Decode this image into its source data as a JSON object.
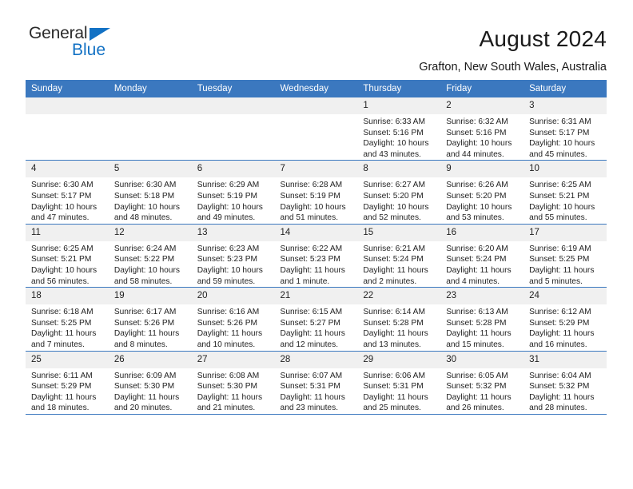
{
  "brand": {
    "name_top": "General",
    "name_bottom": "Blue",
    "triangle_color": "#1271c4",
    "text_color": "#2b2b2b"
  },
  "header": {
    "title": "August 2024",
    "subtitle": "Grafton, New South Wales, Australia",
    "header_bg": "#3b78bf",
    "daynum_bg": "#f0f0f0"
  },
  "weekday_headers": [
    "Sunday",
    "Monday",
    "Tuesday",
    "Wednesday",
    "Thursday",
    "Friday",
    "Saturday"
  ],
  "labels": {
    "sunrise": "Sunrise:",
    "sunset": "Sunset:",
    "daylight": "Daylight:"
  },
  "weeks": [
    [
      {
        "day": "",
        "empty": true
      },
      {
        "day": "",
        "empty": true
      },
      {
        "day": "",
        "empty": true
      },
      {
        "day": "",
        "empty": true
      },
      {
        "day": "1",
        "sunrise": "Sunrise: 6:33 AM",
        "sunset": "Sunset: 5:16 PM",
        "daylight1": "Daylight: 10 hours",
        "daylight2": "and 43 minutes."
      },
      {
        "day": "2",
        "sunrise": "Sunrise: 6:32 AM",
        "sunset": "Sunset: 5:16 PM",
        "daylight1": "Daylight: 10 hours",
        "daylight2": "and 44 minutes."
      },
      {
        "day": "3",
        "sunrise": "Sunrise: 6:31 AM",
        "sunset": "Sunset: 5:17 PM",
        "daylight1": "Daylight: 10 hours",
        "daylight2": "and 45 minutes."
      }
    ],
    [
      {
        "day": "4",
        "sunrise": "Sunrise: 6:30 AM",
        "sunset": "Sunset: 5:17 PM",
        "daylight1": "Daylight: 10 hours",
        "daylight2": "and 47 minutes."
      },
      {
        "day": "5",
        "sunrise": "Sunrise: 6:30 AM",
        "sunset": "Sunset: 5:18 PM",
        "daylight1": "Daylight: 10 hours",
        "daylight2": "and 48 minutes."
      },
      {
        "day": "6",
        "sunrise": "Sunrise: 6:29 AM",
        "sunset": "Sunset: 5:19 PM",
        "daylight1": "Daylight: 10 hours",
        "daylight2": "and 49 minutes."
      },
      {
        "day": "7",
        "sunrise": "Sunrise: 6:28 AM",
        "sunset": "Sunset: 5:19 PM",
        "daylight1": "Daylight: 10 hours",
        "daylight2": "and 51 minutes."
      },
      {
        "day": "8",
        "sunrise": "Sunrise: 6:27 AM",
        "sunset": "Sunset: 5:20 PM",
        "daylight1": "Daylight: 10 hours",
        "daylight2": "and 52 minutes."
      },
      {
        "day": "9",
        "sunrise": "Sunrise: 6:26 AM",
        "sunset": "Sunset: 5:20 PM",
        "daylight1": "Daylight: 10 hours",
        "daylight2": "and 53 minutes."
      },
      {
        "day": "10",
        "sunrise": "Sunrise: 6:25 AM",
        "sunset": "Sunset: 5:21 PM",
        "daylight1": "Daylight: 10 hours",
        "daylight2": "and 55 minutes."
      }
    ],
    [
      {
        "day": "11",
        "sunrise": "Sunrise: 6:25 AM",
        "sunset": "Sunset: 5:21 PM",
        "daylight1": "Daylight: 10 hours",
        "daylight2": "and 56 minutes."
      },
      {
        "day": "12",
        "sunrise": "Sunrise: 6:24 AM",
        "sunset": "Sunset: 5:22 PM",
        "daylight1": "Daylight: 10 hours",
        "daylight2": "and 58 minutes."
      },
      {
        "day": "13",
        "sunrise": "Sunrise: 6:23 AM",
        "sunset": "Sunset: 5:23 PM",
        "daylight1": "Daylight: 10 hours",
        "daylight2": "and 59 minutes."
      },
      {
        "day": "14",
        "sunrise": "Sunrise: 6:22 AM",
        "sunset": "Sunset: 5:23 PM",
        "daylight1": "Daylight: 11 hours",
        "daylight2": "and 1 minute."
      },
      {
        "day": "15",
        "sunrise": "Sunrise: 6:21 AM",
        "sunset": "Sunset: 5:24 PM",
        "daylight1": "Daylight: 11 hours",
        "daylight2": "and 2 minutes."
      },
      {
        "day": "16",
        "sunrise": "Sunrise: 6:20 AM",
        "sunset": "Sunset: 5:24 PM",
        "daylight1": "Daylight: 11 hours",
        "daylight2": "and 4 minutes."
      },
      {
        "day": "17",
        "sunrise": "Sunrise: 6:19 AM",
        "sunset": "Sunset: 5:25 PM",
        "daylight1": "Daylight: 11 hours",
        "daylight2": "and 5 minutes."
      }
    ],
    [
      {
        "day": "18",
        "sunrise": "Sunrise: 6:18 AM",
        "sunset": "Sunset: 5:25 PM",
        "daylight1": "Daylight: 11 hours",
        "daylight2": "and 7 minutes."
      },
      {
        "day": "19",
        "sunrise": "Sunrise: 6:17 AM",
        "sunset": "Sunset: 5:26 PM",
        "daylight1": "Daylight: 11 hours",
        "daylight2": "and 8 minutes."
      },
      {
        "day": "20",
        "sunrise": "Sunrise: 6:16 AM",
        "sunset": "Sunset: 5:26 PM",
        "daylight1": "Daylight: 11 hours",
        "daylight2": "and 10 minutes."
      },
      {
        "day": "21",
        "sunrise": "Sunrise: 6:15 AM",
        "sunset": "Sunset: 5:27 PM",
        "daylight1": "Daylight: 11 hours",
        "daylight2": "and 12 minutes."
      },
      {
        "day": "22",
        "sunrise": "Sunrise: 6:14 AM",
        "sunset": "Sunset: 5:28 PM",
        "daylight1": "Daylight: 11 hours",
        "daylight2": "and 13 minutes."
      },
      {
        "day": "23",
        "sunrise": "Sunrise: 6:13 AM",
        "sunset": "Sunset: 5:28 PM",
        "daylight1": "Daylight: 11 hours",
        "daylight2": "and 15 minutes."
      },
      {
        "day": "24",
        "sunrise": "Sunrise: 6:12 AM",
        "sunset": "Sunset: 5:29 PM",
        "daylight1": "Daylight: 11 hours",
        "daylight2": "and 16 minutes."
      }
    ],
    [
      {
        "day": "25",
        "sunrise": "Sunrise: 6:11 AM",
        "sunset": "Sunset: 5:29 PM",
        "daylight1": "Daylight: 11 hours",
        "daylight2": "and 18 minutes."
      },
      {
        "day": "26",
        "sunrise": "Sunrise: 6:09 AM",
        "sunset": "Sunset: 5:30 PM",
        "daylight1": "Daylight: 11 hours",
        "daylight2": "and 20 minutes."
      },
      {
        "day": "27",
        "sunrise": "Sunrise: 6:08 AM",
        "sunset": "Sunset: 5:30 PM",
        "daylight1": "Daylight: 11 hours",
        "daylight2": "and 21 minutes."
      },
      {
        "day": "28",
        "sunrise": "Sunrise: 6:07 AM",
        "sunset": "Sunset: 5:31 PM",
        "daylight1": "Daylight: 11 hours",
        "daylight2": "and 23 minutes."
      },
      {
        "day": "29",
        "sunrise": "Sunrise: 6:06 AM",
        "sunset": "Sunset: 5:31 PM",
        "daylight1": "Daylight: 11 hours",
        "daylight2": "and 25 minutes."
      },
      {
        "day": "30",
        "sunrise": "Sunrise: 6:05 AM",
        "sunset": "Sunset: 5:32 PM",
        "daylight1": "Daylight: 11 hours",
        "daylight2": "and 26 minutes."
      },
      {
        "day": "31",
        "sunrise": "Sunrise: 6:04 AM",
        "sunset": "Sunset: 5:32 PM",
        "daylight1": "Daylight: 11 hours",
        "daylight2": "and 28 minutes."
      }
    ]
  ]
}
